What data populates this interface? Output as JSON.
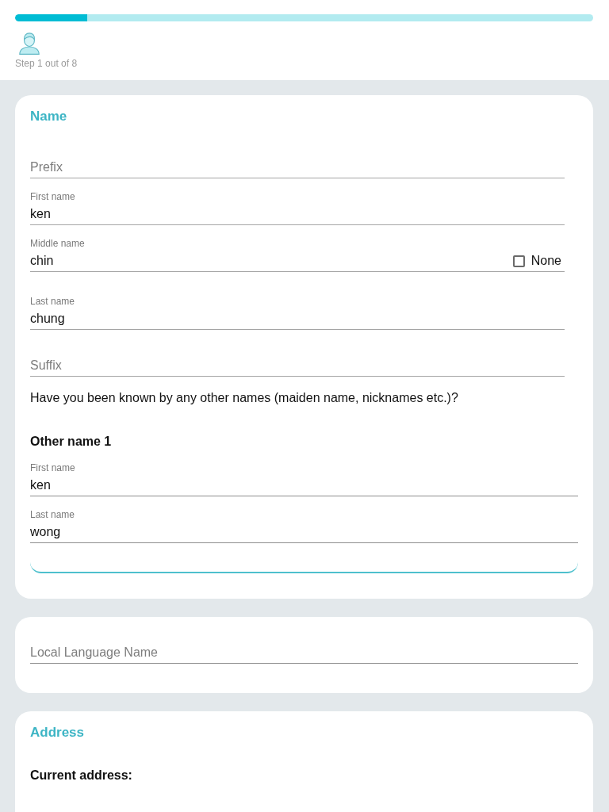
{
  "progress": {
    "level": 0.125,
    "step_label": "Step 1 out of 8"
  },
  "name_section": {
    "title": "Name",
    "fields": [
      {
        "placeholder": "Prefix"
      },
      {
        "label": "First name",
        "value": "ken"
      },
      {
        "label": "Middle name",
        "value": "chin",
        "none_checkbox": {
          "label": "None",
          "checked": false
        }
      },
      {
        "label": "Last name",
        "value": "chung"
      },
      {
        "placeholder": "Suffix"
      }
    ],
    "other_names_question": "Have you been known by any other names (maiden name, nicknames etc.)?",
    "other_names": [
      {
        "title": "Other name 1",
        "fields": [
          {
            "label": "First name",
            "value": "ken"
          },
          {
            "label": "Last name",
            "value": "wong"
          }
        ]
      }
    ]
  },
  "local_language_name": {
    "placeholder": "Local Language Name"
  },
  "address_section": {
    "title": "Address",
    "subtitle": "Current address:"
  }
}
